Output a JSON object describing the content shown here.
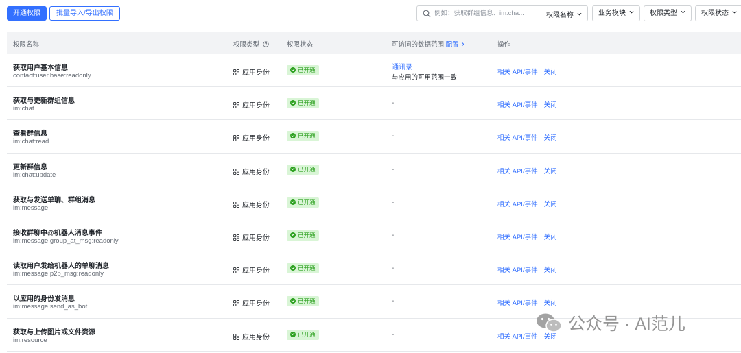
{
  "toolbar": {
    "enable_button": "开通权限",
    "batch_button": "批量导入/导出权限"
  },
  "search": {
    "placeholder": "例如：获取群组信息、im:cha...",
    "select_label": "权限名称"
  },
  "filters": [
    "业务模块",
    "权限类型",
    "权限状态"
  ],
  "table": {
    "headers": {
      "name": "权限名称",
      "type": "权限类型",
      "status": "权限状态",
      "scope": "可访问的数据范围",
      "scope_link": "配置",
      "actions": "操作"
    },
    "rows": [
      {
        "title": "获取用户基本信息",
        "code": "contact:user.base:readonly",
        "type": "应用身份",
        "status": "已开通",
        "scope_link": "通讯录",
        "scope_text": "与应用的可用范围一致",
        "action_api": "相关 API/事件",
        "action_close": "关闭"
      },
      {
        "title": "获取与更新群组信息",
        "code": "im:chat",
        "type": "应用身份",
        "status": "已开通",
        "scope": "-",
        "action_api": "相关 API/事件",
        "action_close": "关闭"
      },
      {
        "title": "查看群信息",
        "code": "im:chat:read",
        "type": "应用身份",
        "status": "已开通",
        "scope": "-",
        "action_api": "相关 API/事件",
        "action_close": "关闭"
      },
      {
        "title": "更新群信息",
        "code": "im:chat:update",
        "type": "应用身份",
        "status": "已开通",
        "scope": "-",
        "action_api": "相关 API/事件",
        "action_close": "关闭"
      },
      {
        "title": "获取与发送单聊、群组消息",
        "code": "im:message",
        "type": "应用身份",
        "status": "已开通",
        "scope": "-",
        "action_api": "相关 API/事件",
        "action_close": "关闭"
      },
      {
        "title": "接收群聊中@机器人消息事件",
        "code": "im:message.group_at_msg:readonly",
        "type": "应用身份",
        "status": "已开通",
        "scope": "-",
        "action_api": "相关 API/事件",
        "action_close": "关闭"
      },
      {
        "title": "读取用户发给机器人的单聊消息",
        "code": "im:message.p2p_msg:readonly",
        "type": "应用身份",
        "status": "已开通",
        "scope": "-",
        "action_api": "相关 API/事件",
        "action_close": "关闭"
      },
      {
        "title": "以应用的身份发消息",
        "code": "im:message:send_as_bot",
        "type": "应用身份",
        "status": "已开通",
        "scope": "-",
        "action_api": "相关 API/事件",
        "action_close": "关闭"
      },
      {
        "title": "获取与上传图片或文件资源",
        "code": "im:resource",
        "type": "应用身份",
        "status": "已开通",
        "scope": "-",
        "action_api": "相关 API/事件",
        "action_close": "关闭"
      }
    ]
  },
  "watermark": "公众号 · AI范儿",
  "colors": {
    "accent": "#3370ff",
    "success": "#2ea121",
    "success_bg": "#d9f5d6",
    "header_bg": "#f2f3f5"
  }
}
